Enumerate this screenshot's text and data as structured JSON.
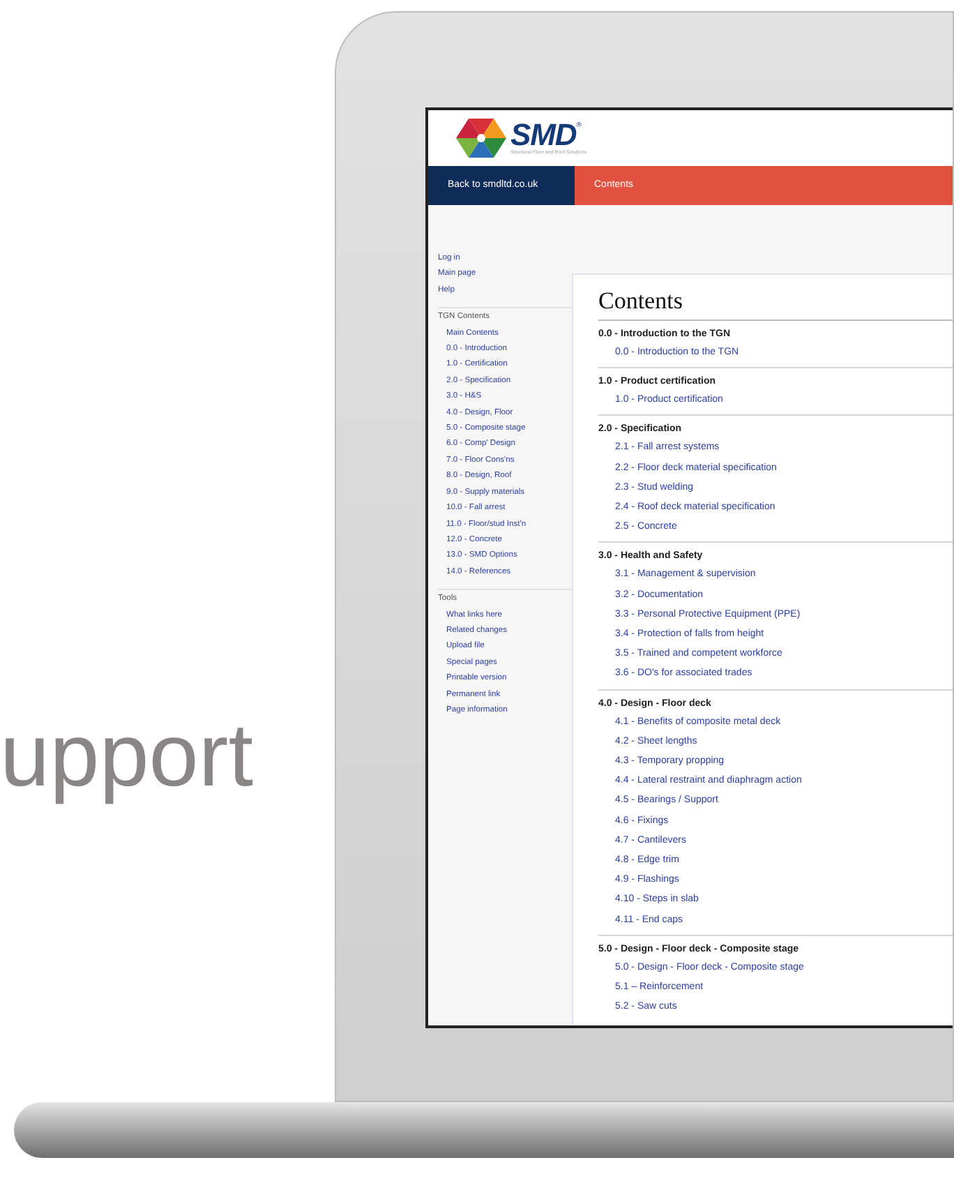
{
  "promo_text": "upport",
  "logo": {
    "name": "SMD",
    "mark": "®",
    "tagline": "Structural Floor and Roof Solutions"
  },
  "nav": [
    {
      "label": "Back to smdltd.co.uk",
      "kind": "back"
    },
    {
      "label": "Contents",
      "kind": "tab"
    }
  ],
  "sidebar": {
    "links": [
      "Log in",
      "Main page",
      "Help"
    ],
    "sections": [
      {
        "title": "TGN Contents",
        "items": [
          "Main Contents",
          "0.0 - Introduction",
          "1.0 - Certification",
          "2.0 - Specification",
          "3.0 - H&S",
          "4.0 - Design, Floor",
          "5.0 - Composite stage",
          "6.0 - Comp' Design",
          "7.0 - Floor Cons'ns",
          "8.0 - Design, Roof",
          "9.0 - Supply materials",
          "10.0 - Fall arrest",
          "11.0 - Floor/stud Inst'n",
          "12.0 - Concrete",
          "13.0 - SMD Options",
          "14.0 - References"
        ]
      },
      {
        "title": "Tools",
        "items": [
          "What links here",
          "Related changes",
          "Upload file",
          "Special pages",
          "Printable version",
          "Permanent link",
          "Page information"
        ]
      }
    ]
  },
  "main": {
    "title": "Contents",
    "sections": [
      {
        "heading": "0.0 - Introduction to the TGN",
        "items": [
          "0.0 - Introduction to the TGN"
        ]
      },
      {
        "heading": "1.0 - Product certification",
        "items": [
          "1.0 - Product certification"
        ]
      },
      {
        "heading": "2.0 - Specification",
        "items": [
          "2.1 - Fall arrest systems",
          "2.2 - Floor deck material specification",
          "2.3 - Stud welding",
          "2.4 - Roof deck material specification",
          "2.5 - Concrete"
        ]
      },
      {
        "heading": "3.0 - Health and Safety",
        "items": [
          "3.1 - Management & supervision",
          "3.2 - Documentation",
          "3.3 - Personal Protective Equipment (PPE)",
          "3.4 - Protection of falls from height",
          "3.5 - Trained and competent workforce",
          "3.6 - DO's for associated trades"
        ]
      },
      {
        "heading": "4.0 - Design - Floor deck",
        "items": [
          "4.1 - Benefits of composite metal deck",
          "4.2 - Sheet lengths",
          "4.3 - Temporary propping",
          "4.4 - Lateral restraint and diaphragm action",
          "4.5 - Bearings / Support",
          "4.6 - Fixings",
          "4.7 - Cantilevers",
          "4.8 - Edge trim",
          "4.9 - Flashings",
          "4.10 - Steps in slab",
          "4.11 - End caps"
        ]
      },
      {
        "heading": "5.0 - Design - Floor deck - Composite stage",
        "items": [
          "5.0 - Design - Floor deck - Composite stage",
          "5.1 – Reinforcement",
          "5.2 - Saw cuts"
        ]
      }
    ]
  }
}
